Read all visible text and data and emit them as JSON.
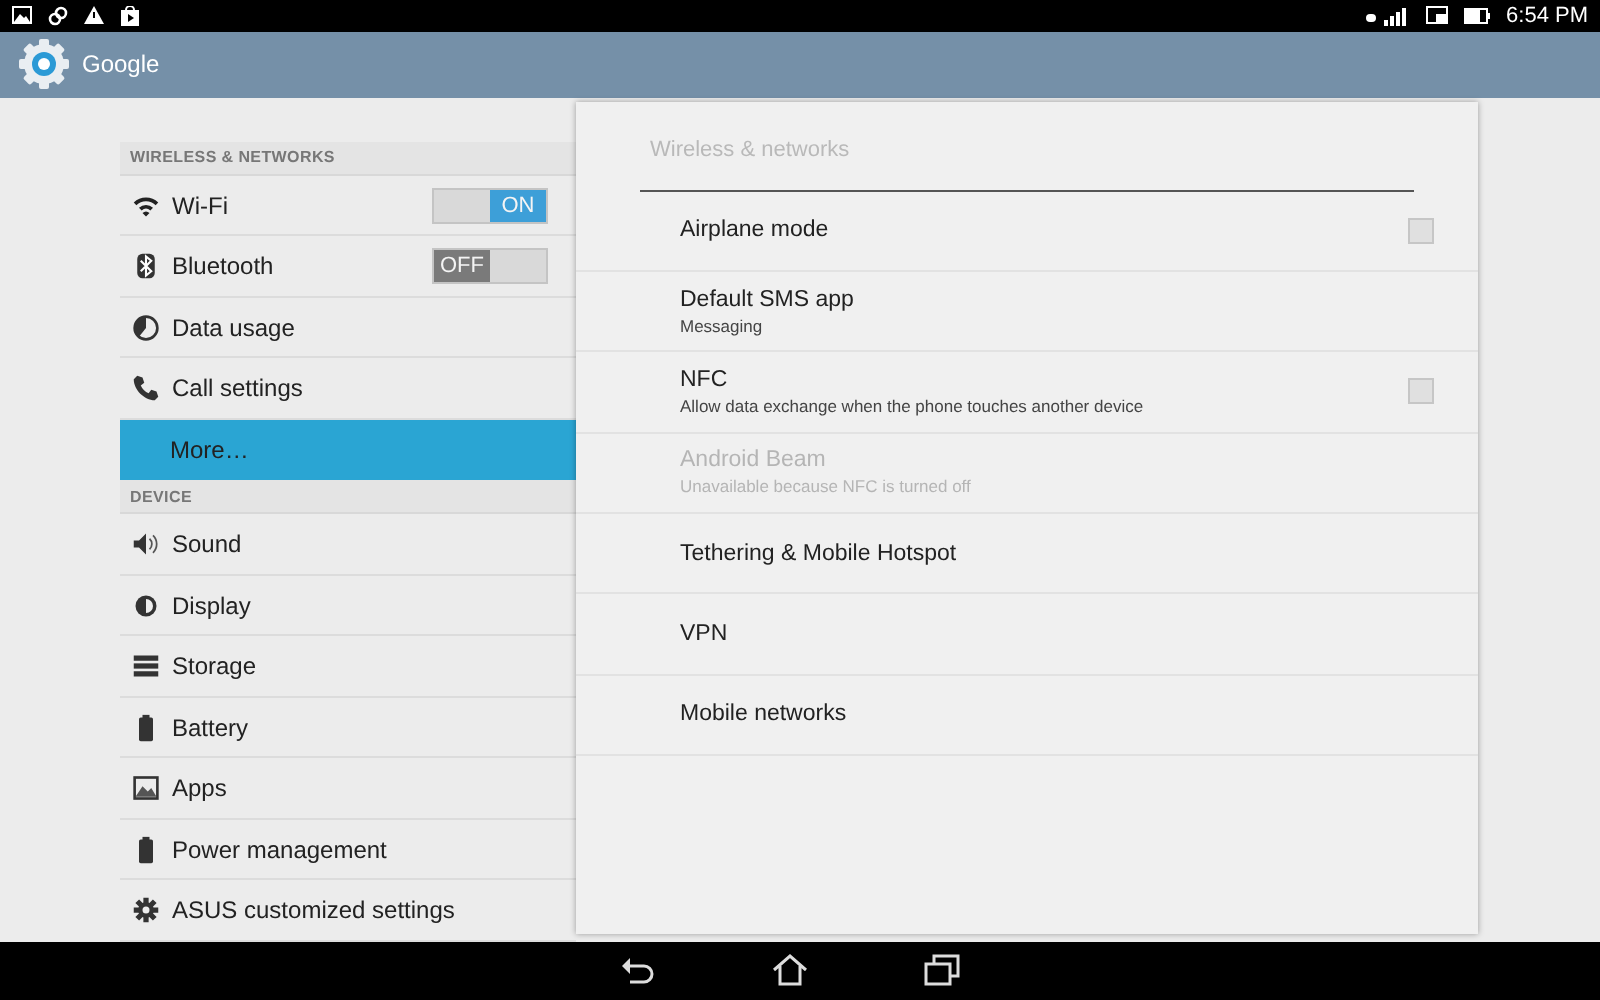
{
  "status_bar": {
    "time": "6:54 PM"
  },
  "action_bar": {
    "title": "Google"
  },
  "sidebar": {
    "sections": [
      {
        "header": "WIRELESS & NETWORKS",
        "items": [
          {
            "kind": "toggle",
            "label": "Wi-Fi",
            "on": true,
            "switch_text": "ON",
            "selected": false
          },
          {
            "kind": "toggle",
            "label": "Bluetooth",
            "on": false,
            "switch_text": "OFF",
            "selected": false
          },
          {
            "kind": "item",
            "label": "Data usage",
            "selected": false
          },
          {
            "kind": "item",
            "label": "Call settings",
            "selected": false
          },
          {
            "kind": "item",
            "label": "More…",
            "selected": true
          }
        ]
      },
      {
        "header": "DEVICE",
        "items": [
          {
            "kind": "item",
            "label": "Sound",
            "selected": false
          },
          {
            "kind": "item",
            "label": "Display",
            "selected": false
          },
          {
            "kind": "item",
            "label": "Storage",
            "selected": false
          },
          {
            "kind": "item",
            "label": "Battery",
            "selected": false
          },
          {
            "kind": "item",
            "label": "Apps",
            "selected": false
          },
          {
            "kind": "item",
            "label": "Power management",
            "selected": false
          },
          {
            "kind": "item",
            "label": "ASUS customized settings",
            "selected": false
          }
        ]
      }
    ]
  },
  "detail": {
    "title": "Wireless & networks",
    "rows": [
      {
        "kind": "checkbox",
        "title": "Airplane mode",
        "checked": false,
        "disabled": false
      },
      {
        "kind": "item",
        "title": "Default SMS app",
        "summary": "Messaging",
        "disabled": false
      },
      {
        "kind": "checkbox",
        "title": "NFC",
        "summary": "Allow data exchange when the phone touches another device",
        "checked": false,
        "disabled": false
      },
      {
        "kind": "item",
        "title": "Android Beam",
        "summary": "Unavailable because NFC is turned off",
        "disabled": true
      },
      {
        "kind": "item",
        "title": "Tethering & Mobile Hotspot",
        "disabled": false
      },
      {
        "kind": "item",
        "title": "VPN",
        "disabled": false
      },
      {
        "kind": "item",
        "title": "Mobile networks",
        "disabled": false
      }
    ]
  }
}
